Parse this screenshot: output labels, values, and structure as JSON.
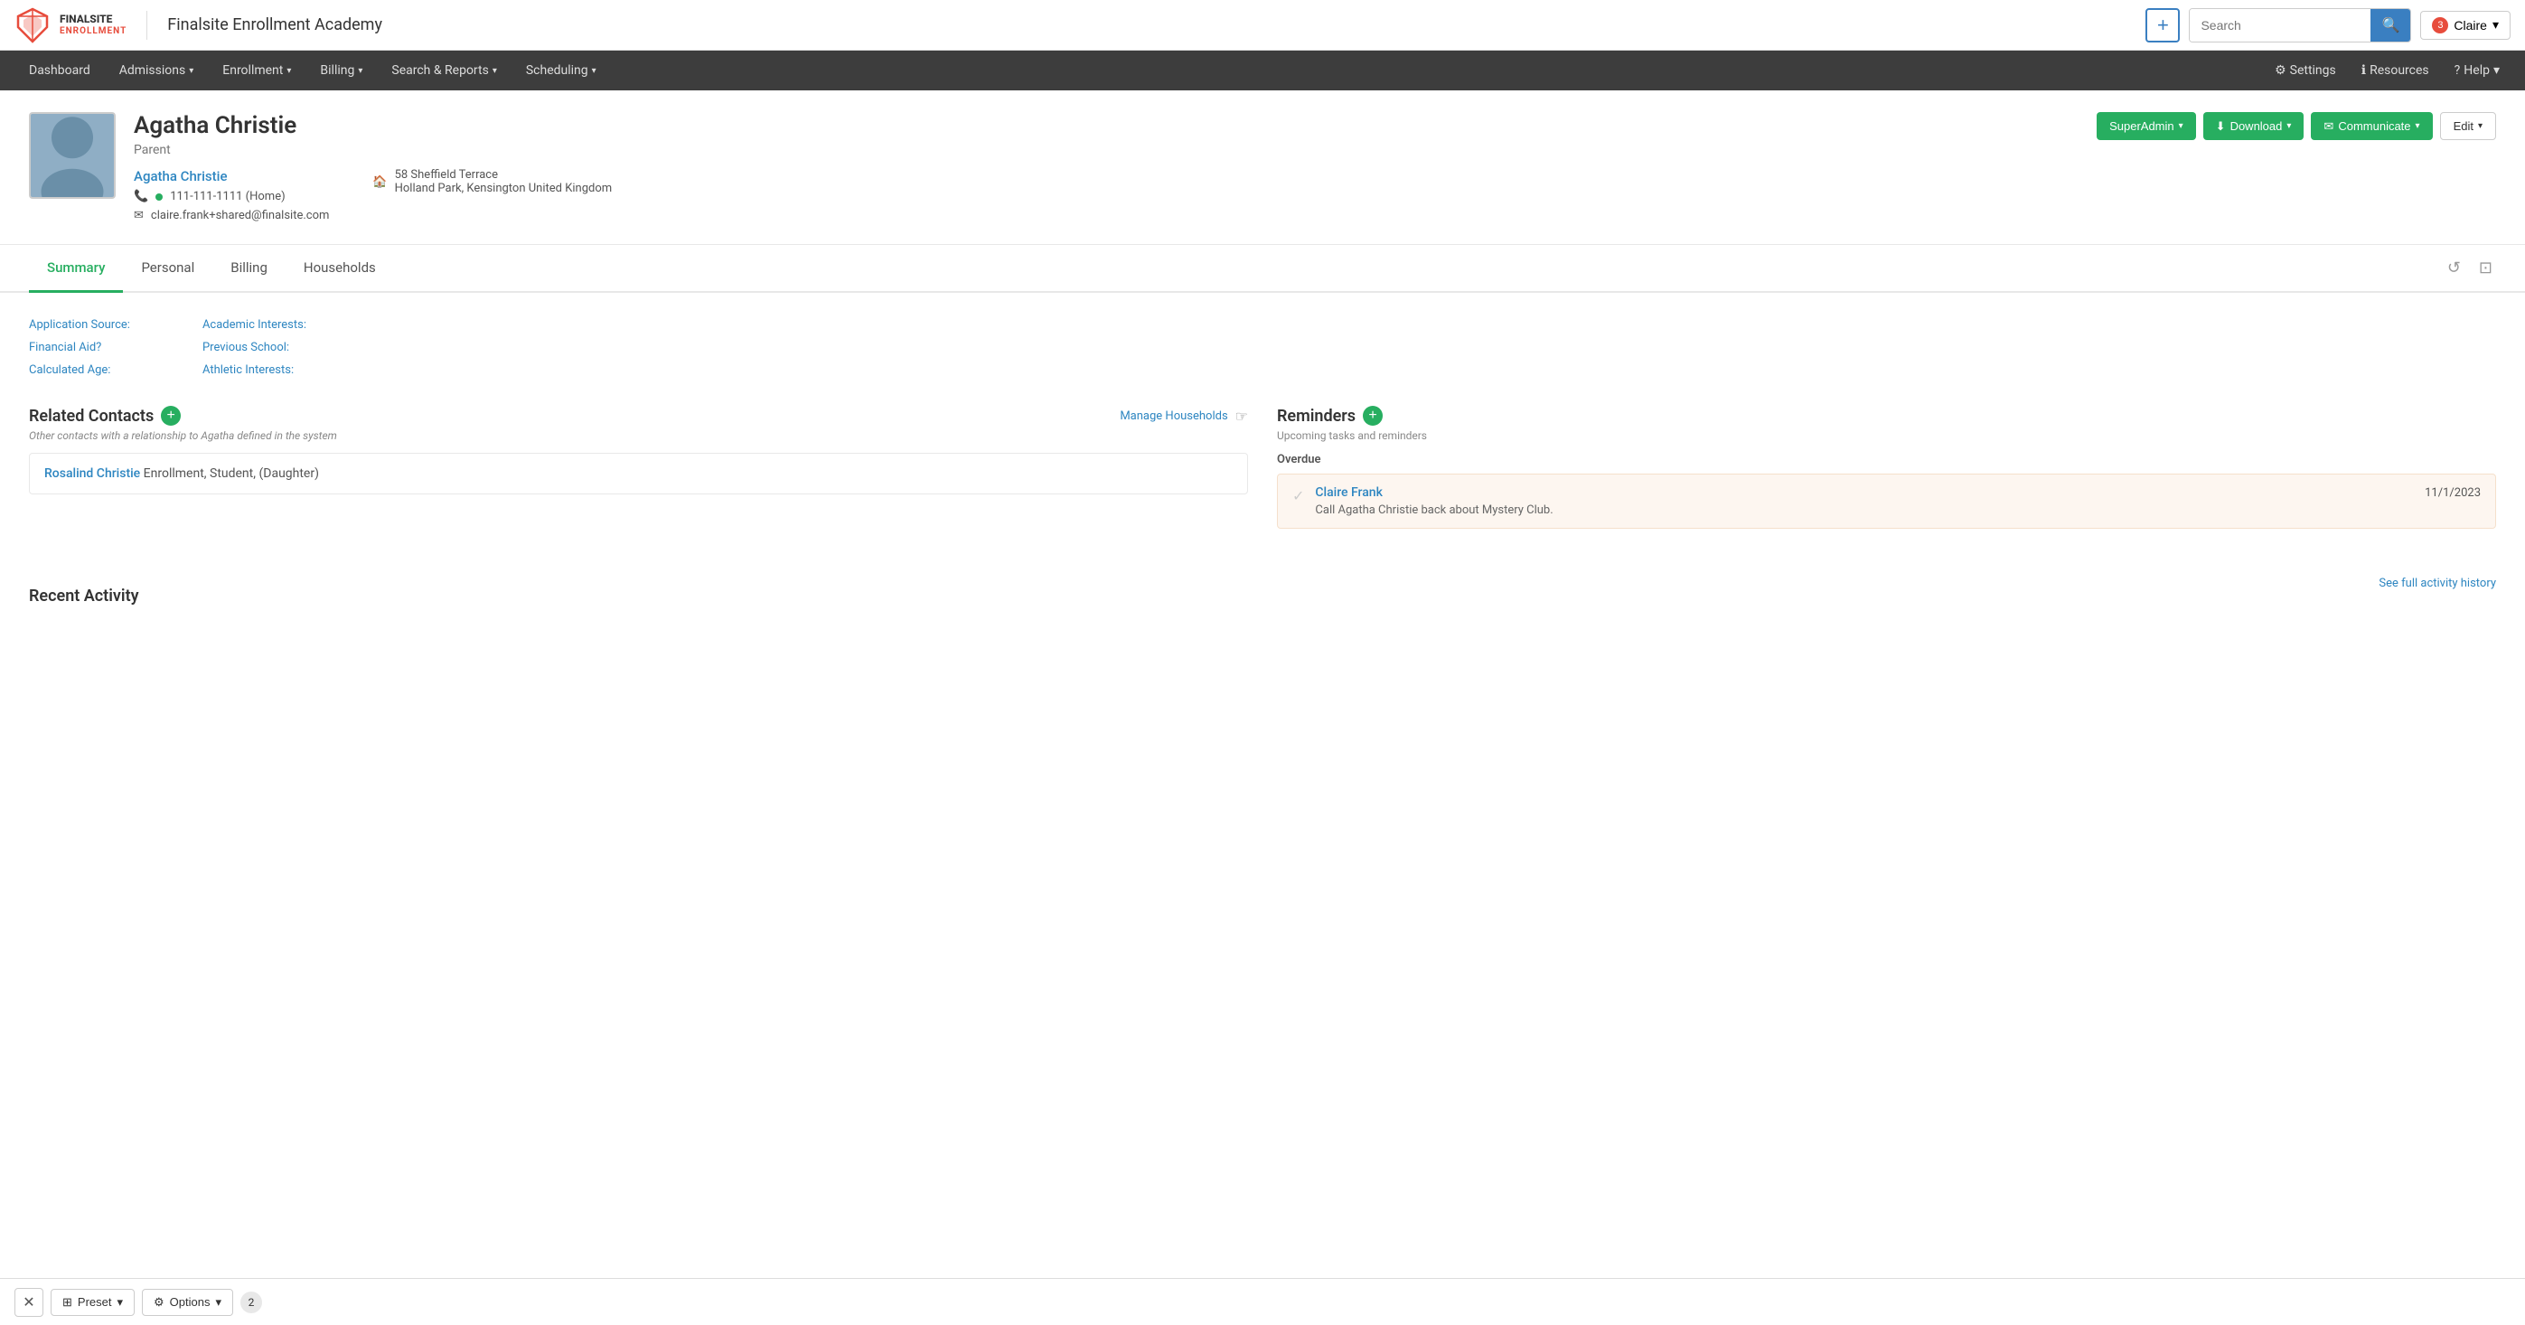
{
  "app": {
    "logo_text": "FINALSITE\nENROLLMENT",
    "title": "Finalsite Enrollment Academy"
  },
  "topbar": {
    "plus_label": "+",
    "search_placeholder": "Search",
    "search_icon": "🔍",
    "notification_count": "3",
    "user_name": "Claire",
    "chevron": "▾"
  },
  "mainnav": {
    "items": [
      {
        "label": "Dashboard",
        "has_dropdown": false
      },
      {
        "label": "Admissions",
        "has_dropdown": true
      },
      {
        "label": "Enrollment",
        "has_dropdown": true
      },
      {
        "label": "Billing",
        "has_dropdown": true
      },
      {
        "label": "Search & Reports",
        "has_dropdown": true
      },
      {
        "label": "Scheduling",
        "has_dropdown": true
      }
    ],
    "right_items": [
      {
        "label": "Settings",
        "icon": "⚙"
      },
      {
        "label": "Resources",
        "icon": "ℹ"
      },
      {
        "label": "Help",
        "icon": "?"
      }
    ]
  },
  "profile": {
    "name": "Agatha Christie",
    "role": "Parent",
    "buttons": {
      "super_admin": "SuperAdmin",
      "download": "Download",
      "communicate": "Communicate",
      "edit": "Edit"
    },
    "contact": {
      "name_link": "Agatha Christie",
      "phone": "111-111-1111 (Home)",
      "email": "claire.frank+shared@finalsite.com",
      "address_line1": "58 Sheffield Terrace",
      "address_line2": "Holland Park, Kensington United Kingdom"
    }
  },
  "tabs": [
    {
      "label": "Summary",
      "active": true
    },
    {
      "label": "Personal",
      "active": false
    },
    {
      "label": "Billing",
      "active": false
    },
    {
      "label": "Households",
      "active": false
    }
  ],
  "info_fields": {
    "left": [
      {
        "label": "Application Source:"
      },
      {
        "label": "Financial Aid?"
      },
      {
        "label": "Calculated Age:"
      }
    ],
    "right": [
      {
        "label": "Academic Interests:"
      },
      {
        "label": "Previous School:"
      },
      {
        "label": "Athletic Interests:"
      }
    ]
  },
  "related_contacts": {
    "title": "Related Contacts",
    "subtitle": "Other contacts with a relationship to Agatha defined in the system",
    "manage_link": "Manage Households",
    "contacts": [
      {
        "name": "Rosalind Christie",
        "description": "Enrollment, Student, (Daughter)"
      }
    ]
  },
  "reminders": {
    "title": "Reminders",
    "subtitle": "Upcoming tasks and reminders",
    "overdue_label": "Overdue",
    "items": [
      {
        "assignee": "Claire Frank",
        "date": "11/1/2023",
        "text": "Call Agatha Christie back about Mystery Club."
      }
    ]
  },
  "recent_activity": {
    "title": "Recent Activity",
    "see_full_link": "See full activity history"
  },
  "bottom_bar": {
    "close_icon": "✕",
    "preset_icon": "⊞",
    "preset_label": "Preset",
    "options_icon": "⚙",
    "options_label": "Options",
    "count": "2"
  }
}
